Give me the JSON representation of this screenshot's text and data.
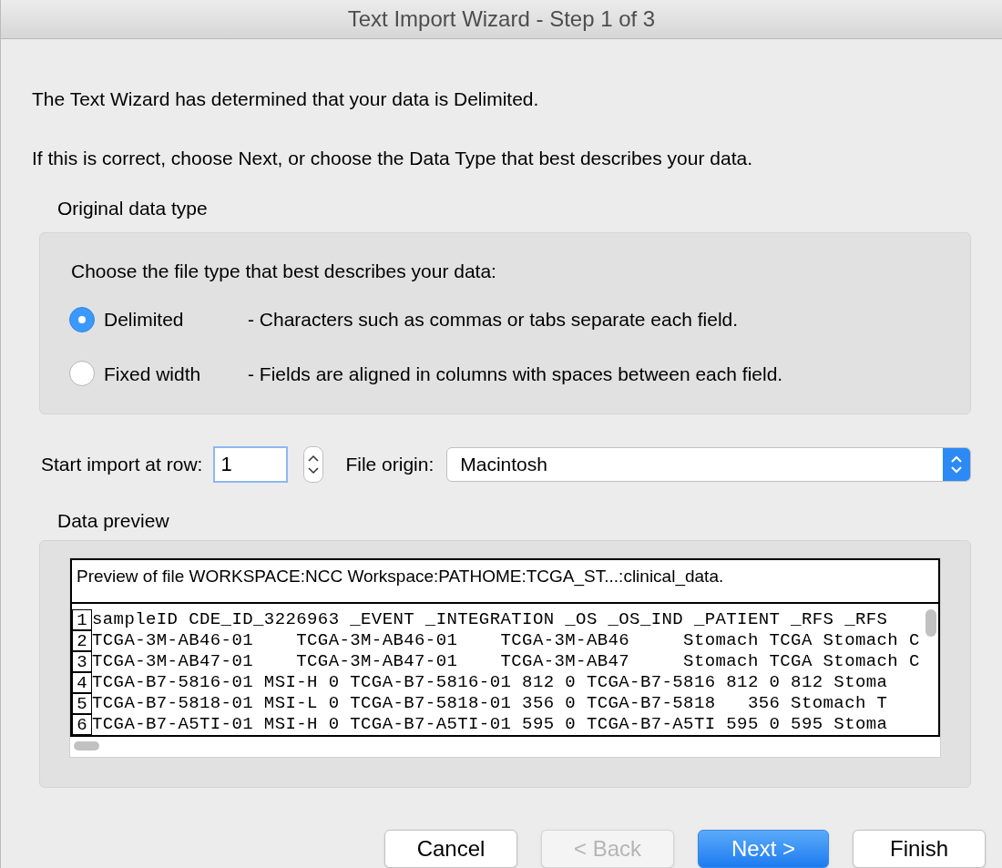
{
  "window": {
    "title": "Text Import Wizard - Step 1 of 3"
  },
  "intro": [
    "The Text Wizard has determined that your data is Delimited.",
    "If this is correct, choose Next, or choose the Data Type that best describes your data."
  ],
  "original_data_type": {
    "title": "Original data type",
    "prompt": "Choose the file type that best describes your data:",
    "options": [
      {
        "label": "Delimited",
        "description": "- Characters such as commas or tabs separate each field.",
        "selected": true
      },
      {
        "label": "Fixed width",
        "description": "- Fields are aligned in columns with spaces between each field.",
        "selected": false
      }
    ]
  },
  "start_row": {
    "label": "Start import at row:",
    "value": "1"
  },
  "file_origin": {
    "label": "File origin:",
    "value": "Macintosh"
  },
  "data_preview": {
    "title": "Data preview",
    "heading": "Preview of file WORKSPACE:NCC Workspace:PATHOME:TCGA_ST...:clinical_data.",
    "lines": [
      {
        "number": "1",
        "text": "sampleID CDE_ID_3226963 _EVENT _INTEGRATION _OS _OS_IND _PATIENT _RFS _RFS"
      },
      {
        "number": "2",
        "text": "TCGA-3M-AB46-01    TCGA-3M-AB46-01    TCGA-3M-AB46     Stomach TCGA Stomach C"
      },
      {
        "number": "3",
        "text": "TCGA-3M-AB47-01    TCGA-3M-AB47-01    TCGA-3M-AB47     Stomach TCGA Stomach C"
      },
      {
        "number": "4",
        "text": "TCGA-B7-5816-01 MSI-H 0 TCGA-B7-5816-01 812 0 TCGA-B7-5816 812 0 812 Stoma"
      },
      {
        "number": "5",
        "text": "TCGA-B7-5818-01 MSI-L 0 TCGA-B7-5818-01 356 0 TCGA-B7-5818   356 Stomach T"
      },
      {
        "number": "6",
        "text": "TCGA-B7-A5TI-01 MSI-H 0 TCGA-B7-A5TI-01 595 0 TCGA-B7-A5TI 595 0 595 Stoma"
      }
    ]
  },
  "buttons": [
    {
      "label": "Cancel",
      "kind": "normal",
      "disabled": false
    },
    {
      "label": "< Back",
      "kind": "normal",
      "disabled": true
    },
    {
      "label": "Next >",
      "kind": "default",
      "disabled": false
    },
    {
      "label": "Finish",
      "kind": "normal",
      "disabled": false
    }
  ]
}
